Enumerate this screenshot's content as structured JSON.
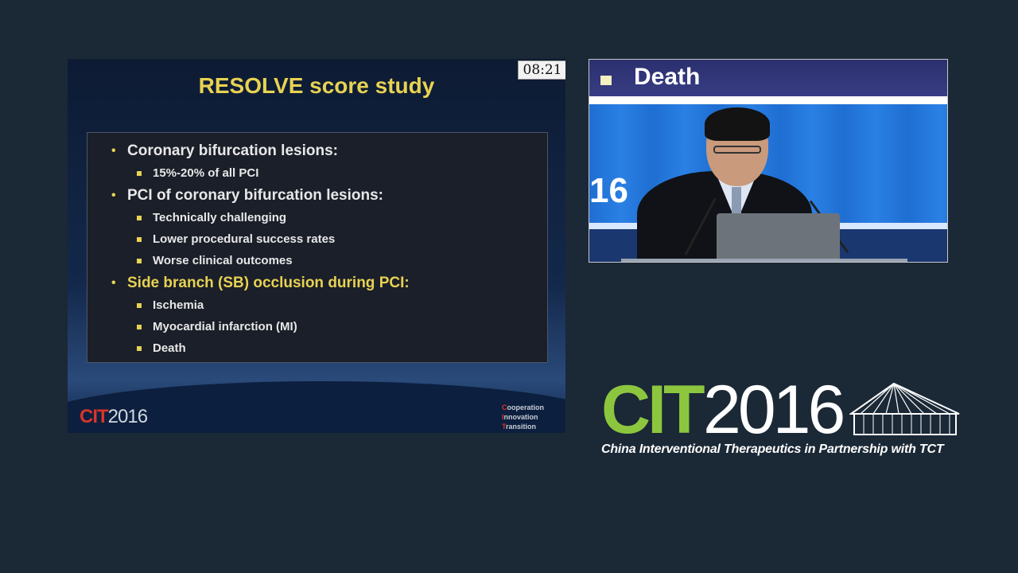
{
  "slide": {
    "title": "RESOLVE score study",
    "timer": "08:21",
    "bullets": [
      {
        "text": "Coronary bifurcation lesions:",
        "highlight": false,
        "sub": [
          "15%-20% of all PCI"
        ]
      },
      {
        "text": "PCI of coronary bifurcation lesions:",
        "highlight": false,
        "sub": [
          "Technically challenging",
          "Lower procedural success rates",
          "Worse clinical outcomes"
        ]
      },
      {
        "text": "Side branch (SB) occlusion during PCI:",
        "highlight": true,
        "sub": [
          "Ischemia",
          "Myocardial infarction (MI)",
          "Death"
        ]
      }
    ],
    "footer_logo": {
      "prefix": "CIT",
      "year": "2016"
    },
    "tagline": [
      {
        "first": "C",
        "rest": "ooperation"
      },
      {
        "first": "I",
        "rest": "nnovation"
      },
      {
        "first": "T",
        "rest": "ransition"
      }
    ]
  },
  "video": {
    "screen_label": "Death",
    "backdrop_text": "16"
  },
  "event": {
    "logo_prefix": "CIT",
    "logo_year": "2016",
    "subtitle": "China Interventional Therapeutics in Partnership with TCT"
  },
  "colors": {
    "background": "#1b2836",
    "slide_title": "#e8d252",
    "accent_red": "#d9342b",
    "logo_green": "#8cc63f"
  }
}
